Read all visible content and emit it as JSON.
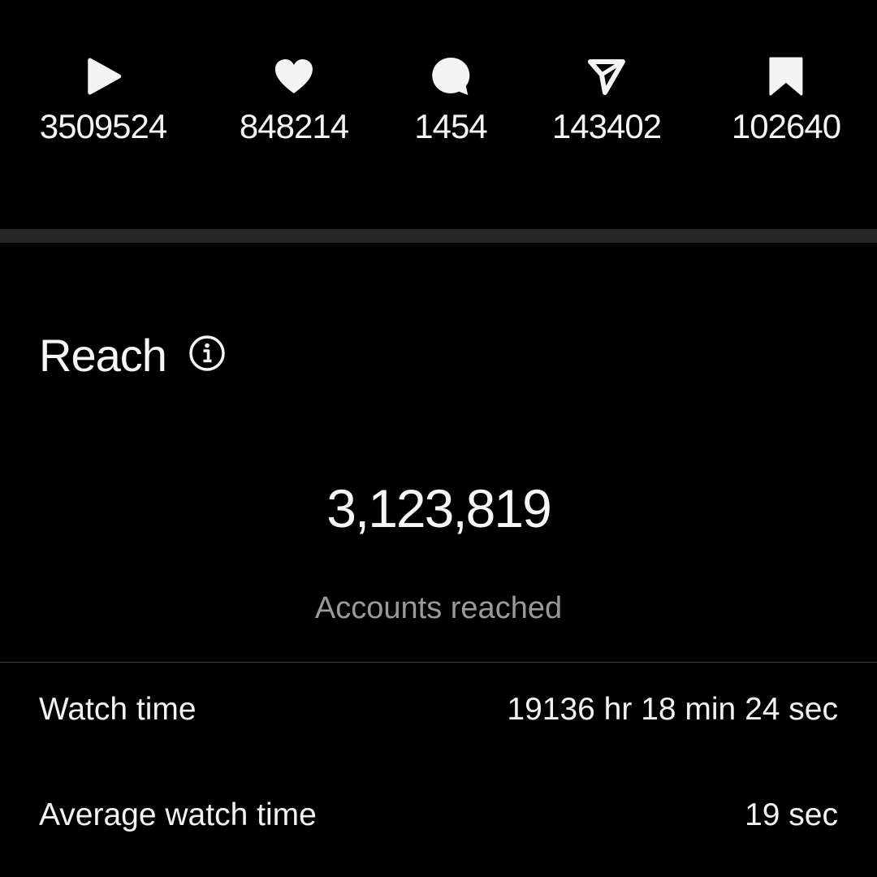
{
  "stats": [
    {
      "icon": "play-icon",
      "count": "3509524"
    },
    {
      "icon": "heart-icon",
      "count": "848214"
    },
    {
      "icon": "comment-icon",
      "count": "1454"
    },
    {
      "icon": "share-icon",
      "count": "143402"
    },
    {
      "icon": "bookmark-icon",
      "count": "102640"
    }
  ],
  "reach": {
    "title": "Reach",
    "value": "3,123,819",
    "caption": "Accounts reached"
  },
  "metrics": {
    "watch_time": {
      "label": "Watch time",
      "value": "19136 hr 18 min 24 sec"
    },
    "average_watch_time": {
      "label": "Average watch time",
      "value": "19 sec"
    }
  },
  "colors": {
    "background": "#000000",
    "text": "#f2f2f2",
    "muted_text": "#9a9a9a",
    "divider": "#262626"
  }
}
